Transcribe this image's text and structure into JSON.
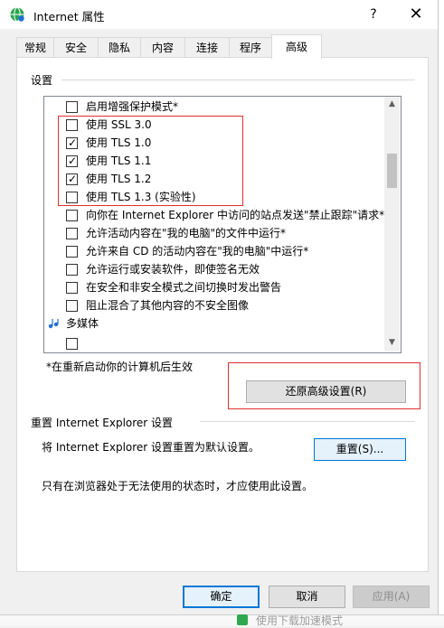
{
  "window": {
    "title": "Internet 属性",
    "help": "?",
    "close": "✕"
  },
  "tabs": [
    "常规",
    "安全",
    "隐私",
    "内容",
    "连接",
    "程序",
    "高级"
  ],
  "active_tab": "高级",
  "settings": {
    "group_label": "设置",
    "items": [
      {
        "type": "checkbox",
        "checked": false,
        "label": "启用增强保护模式*"
      },
      {
        "type": "checkbox",
        "checked": false,
        "label": "使用 SSL 3.0"
      },
      {
        "type": "checkbox",
        "checked": true,
        "label": "使用 TLS 1.0"
      },
      {
        "type": "checkbox",
        "checked": true,
        "label": "使用 TLS 1.1"
      },
      {
        "type": "checkbox",
        "checked": true,
        "label": "使用 TLS 1.2"
      },
      {
        "type": "checkbox",
        "checked": false,
        "label": "使用 TLS 1.3 (实验性)"
      },
      {
        "type": "checkbox",
        "checked": false,
        "label": "向你在 Internet Explorer 中访问的站点发送\"禁止跟踪\"请求*"
      },
      {
        "type": "checkbox",
        "checked": false,
        "label": "允许活动内容在\"我的电脑\"的文件中运行*"
      },
      {
        "type": "checkbox",
        "checked": false,
        "label": "允许来自 CD 的活动内容在\"我的电脑\"中运行*"
      },
      {
        "type": "checkbox",
        "checked": false,
        "label": "允许运行或安装软件，即使签名无效"
      },
      {
        "type": "checkbox",
        "checked": false,
        "label": "在安全和非安全模式之间切换时发出警告"
      },
      {
        "type": "checkbox",
        "checked": false,
        "label": "阻止混合了其他内容的不安全图像"
      },
      {
        "type": "category",
        "label": "多媒体"
      }
    ],
    "restart_note": "*在重新启动你的计算机后生效",
    "restore_button": "还原高级设置(R)"
  },
  "reset": {
    "group_label": "重置 Internet Explorer 设置",
    "description": "将 Internet Explorer 设置重置为默认设置。",
    "reset_button": "重置(S)...",
    "note": "只有在浏览器处于无法使用的状态时，才应使用此设置。"
  },
  "footer": {
    "ok": "确定",
    "cancel": "取消",
    "apply": "应用(A)"
  },
  "background_window": {
    "bottom_text": "使用下载加速模式"
  },
  "colors": {
    "highlight_box": "#e03030",
    "focus_border": "#0078d7",
    "panel_bg": "#ffffff",
    "dialog_bg": "#f0f0f0"
  }
}
